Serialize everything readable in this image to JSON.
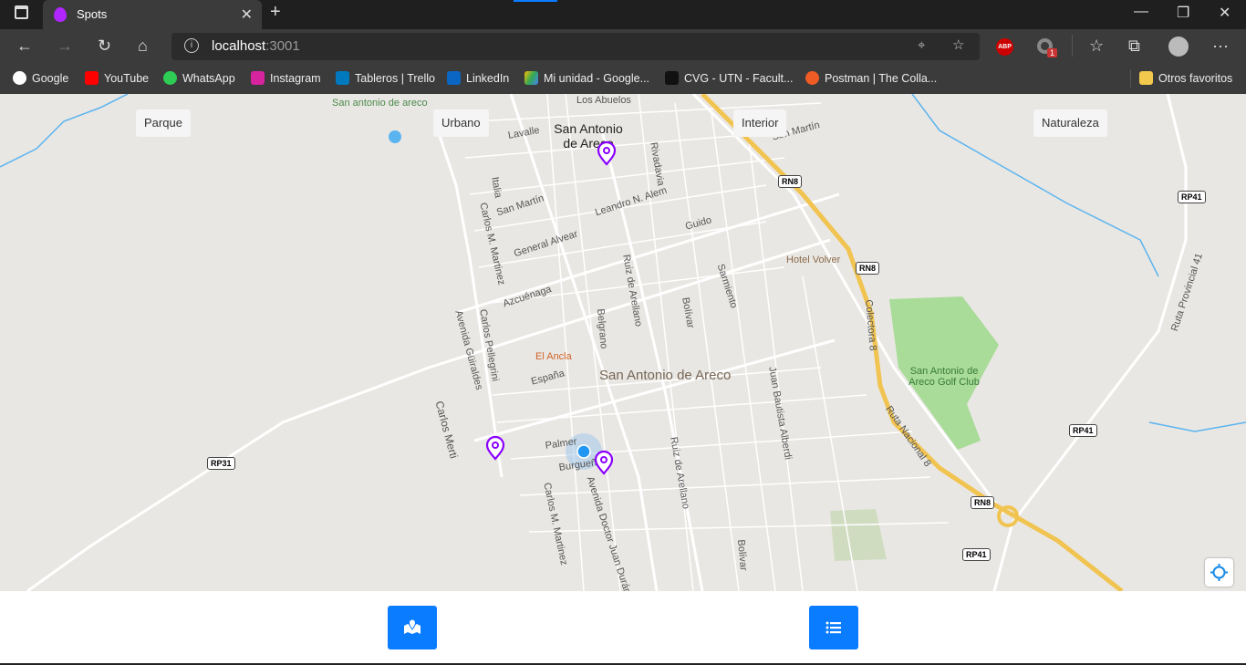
{
  "browser": {
    "tab_title": "Spots",
    "url_host": "localhost",
    "url_port": ":3001",
    "abp_label": "ABP",
    "ext_badge": "1",
    "bookmarks": [
      "Google",
      "YouTube",
      "WhatsApp",
      "Instagram",
      "Tableros | Trello",
      "LinkedIn",
      "Mi unidad - Google...",
      "CVG - UTN - Facult...",
      "Postman | The Colla..."
    ],
    "other_favorites": "Otros favoritos"
  },
  "filters": [
    "Parque",
    "Urbano",
    "Interior",
    "Naturaleza"
  ],
  "map": {
    "labels": [
      "San antonio de areco",
      "San Antonio de Areco",
      "Lavalle",
      "Rivadavia",
      "San Martín",
      "Italia",
      "San Martín",
      "Leandro N. Alem",
      "Carlos M. Martinez",
      "General Alvear",
      "Guido",
      "Ruiz de Arellano",
      "Sarmiento",
      "Azcuénaga",
      "Hotel Volver",
      "Colectora 8",
      "Bolívar",
      "Carlos Pellegrini",
      "Avenida Güiraldes",
      "Belgrano",
      "El Ancla",
      "San Antonio de Areco",
      "España",
      "Juan Bautista Alberdi",
      "San Antonio de Areco Golf Club",
      "Ruta Provincial 41",
      "Carlos Merti",
      "Ruta Nacional 8",
      "Palmer",
      "Burgueño",
      "Carlos M. Martinez",
      "Avenida Doctor Juan Durán",
      "Ruiz de Arellano",
      "Bolívar",
      "Los Abuelos"
    ],
    "shields": [
      "RN8",
      "RN8",
      "RP41",
      "RP41",
      "RP31",
      "RN8",
      "RP41"
    ],
    "accent": "#8a00ff"
  },
  "bottom_nav": {
    "map_icon": "map-marker-icon",
    "list_icon": "list-icon",
    "color": "#0a7cff"
  }
}
